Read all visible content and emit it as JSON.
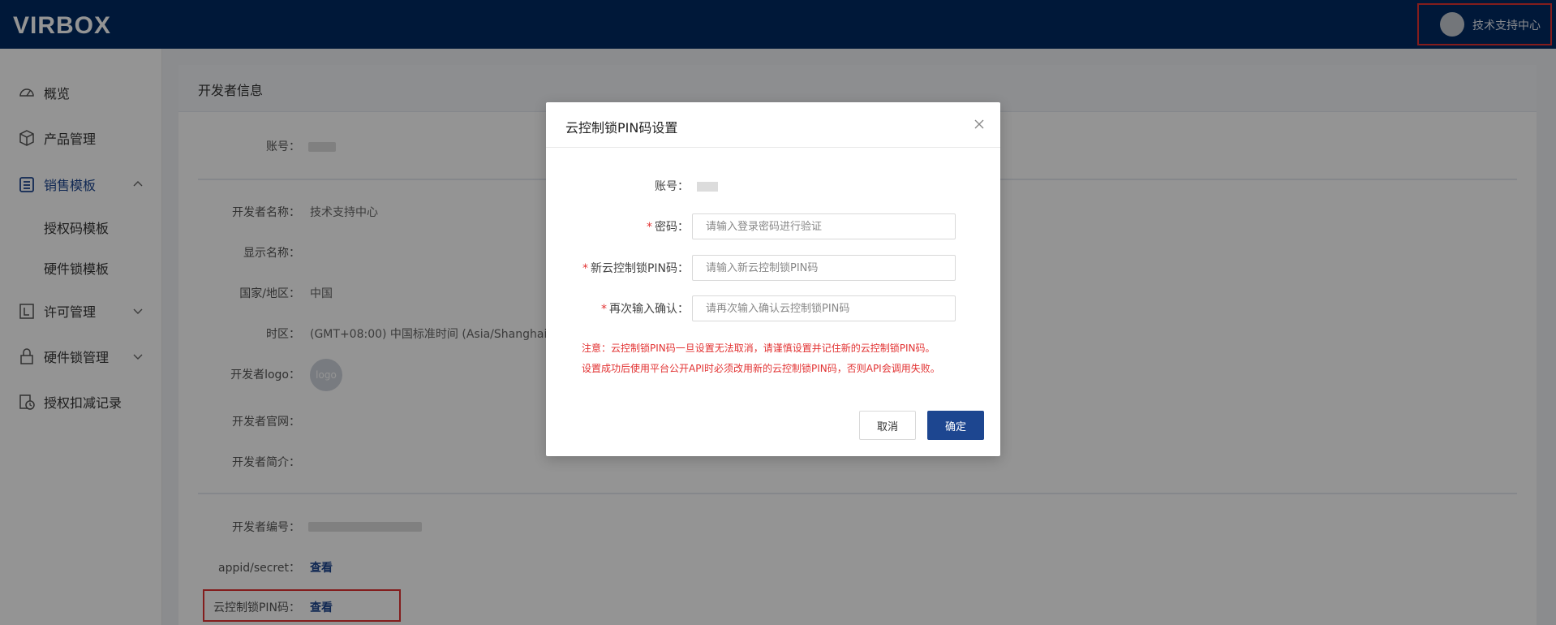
{
  "header": {
    "logo_text": "VIRBOX",
    "user_name": "技术支持中心"
  },
  "sidebar": {
    "items": [
      {
        "label": "概览",
        "icon": "dashboard-icon"
      },
      {
        "label": "产品管理",
        "icon": "box-icon"
      },
      {
        "label": "销售模板",
        "icon": "list-icon",
        "expanded": true,
        "children": [
          {
            "label": "授权码模板"
          },
          {
            "label": "硬件锁模板"
          }
        ]
      },
      {
        "label": "许可管理",
        "icon": "license-icon"
      },
      {
        "label": "硬件锁管理",
        "icon": "lock-icon"
      },
      {
        "label": "授权扣减记录",
        "icon": "record-icon"
      }
    ]
  },
  "panel": {
    "title": "开发者信息",
    "account_label": "账号：",
    "developer_name_label": "开发者名称：",
    "developer_name_value": "技术支持中心",
    "display_name_label": "显示名称：",
    "country_label": "国家/地区：",
    "country_value": "中国",
    "timezone_label": "时区：",
    "timezone_value": "(GMT+08:00) 中国标准时间 (Asia/Shanghai)",
    "logo_label": "开发者logo：",
    "logo_placeholder": "logo",
    "website_label": "开发者官网：",
    "intro_label": "开发者简介：",
    "dev_id_label": "开发者编号：",
    "appid_label": "appid/secret：",
    "appid_link": "查看",
    "pin_label": "云控制锁PIN码：",
    "pin_link": "查看"
  },
  "modal": {
    "title": "云控制锁PIN码设置",
    "account_label": "账号：",
    "password_label": "密码：",
    "password_placeholder": "请输入登录密码进行验证",
    "new_pin_label": "新云控制锁PIN码：",
    "new_pin_placeholder": "请输入新云控制锁PIN码",
    "confirm_label": "再次输入确认：",
    "confirm_placeholder": "请再次输入确认云控制锁PIN码",
    "required_mark": "*",
    "notice_line1": "注意：云控制锁PIN码一旦设置无法取消，请谨慎设置并记住新的云控制锁PIN码。",
    "notice_line2": "设置成功后使用平台公开API时必须改用新的云控制锁PIN码，否则API会调用失败。",
    "cancel_label": "取消",
    "ok_label": "确定"
  },
  "colors": {
    "topbar": "#012a63",
    "accent": "#1d4690",
    "highlight": "#e23232",
    "warning_text": "#e23232"
  }
}
